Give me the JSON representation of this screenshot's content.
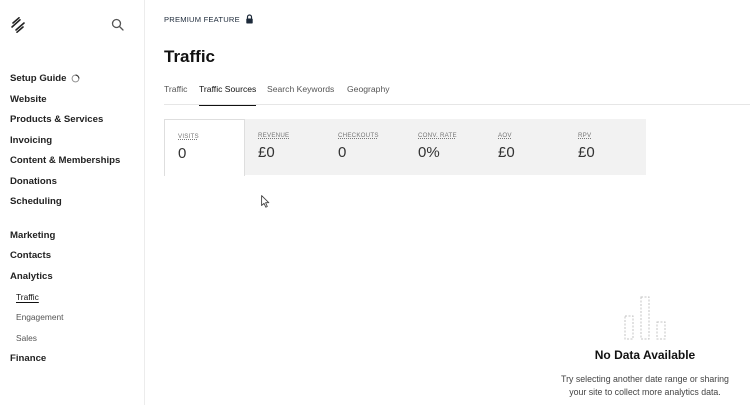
{
  "sidebar": {
    "items": [
      {
        "label": "Setup Guide"
      },
      {
        "label": "Website"
      },
      {
        "label": "Products & Services"
      },
      {
        "label": "Invoicing"
      },
      {
        "label": "Content & Memberships"
      },
      {
        "label": "Donations"
      },
      {
        "label": "Scheduling"
      },
      {
        "label": "Marketing"
      },
      {
        "label": "Contacts"
      },
      {
        "label": "Analytics"
      },
      {
        "label": "Finance"
      }
    ],
    "analytics_sub": [
      {
        "label": "Traffic",
        "active": true
      },
      {
        "label": "Engagement"
      },
      {
        "label": "Sales"
      }
    ]
  },
  "header": {
    "premium_label": "PREMIUM FEATURE",
    "title": "Traffic"
  },
  "tabs": [
    {
      "label": "Traffic"
    },
    {
      "label": "Traffic Sources",
      "active": true
    },
    {
      "label": "Search Keywords"
    },
    {
      "label": "Geography"
    }
  ],
  "metrics": [
    {
      "label": "VISITS",
      "value": "0",
      "active": true
    },
    {
      "label": "REVENUE",
      "value": "£0"
    },
    {
      "label": "CHECKOUTS",
      "value": "0"
    },
    {
      "label": "CONV. RATE",
      "value": "0%"
    },
    {
      "label": "AOV",
      "value": "£0"
    },
    {
      "label": "RPV",
      "value": "£0"
    }
  ],
  "empty_state": {
    "title": "No Data Available",
    "line1": "Try selecting another date range or sharing",
    "line2": "your site to collect more analytics data."
  }
}
